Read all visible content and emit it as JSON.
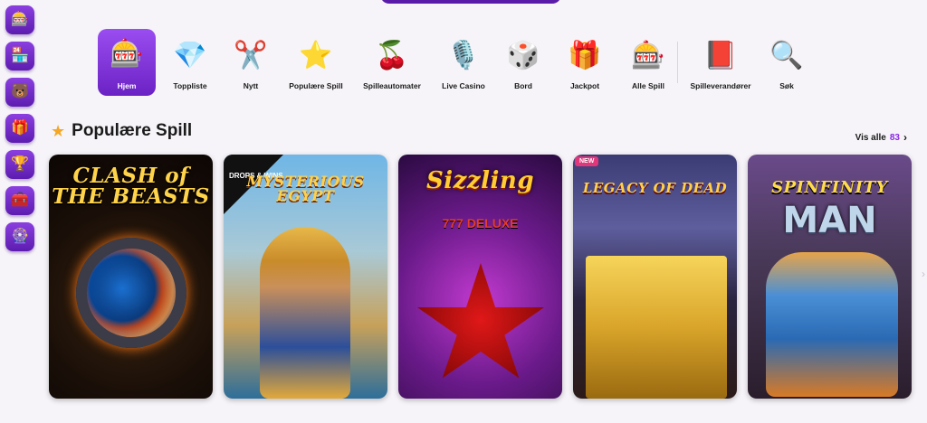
{
  "left_rail": [
    {
      "icon": "slot-machine-icon",
      "glyph": "🎰"
    },
    {
      "icon": "shop-icon",
      "glyph": "🏪"
    },
    {
      "icon": "mascot-icon",
      "glyph": "🐻"
    },
    {
      "icon": "gift-icon",
      "glyph": "🎁"
    },
    {
      "icon": "trophy-icon",
      "glyph": "🏆"
    },
    {
      "icon": "treasure-chest-icon",
      "glyph": "🧰"
    },
    {
      "icon": "wheel-icon",
      "glyph": "🎡"
    }
  ],
  "nav": {
    "items": [
      {
        "label": "Hjem",
        "icon": "home-slot-icon",
        "glyph": "🎰"
      },
      {
        "label": "Toppliste",
        "icon": "gem-icon",
        "glyph": "💎"
      },
      {
        "label": "Nytt",
        "icon": "scissors-ribbon-icon",
        "glyph": "✂️"
      },
      {
        "label": "Populære Spill",
        "icon": "star-icon",
        "glyph": "⭐"
      },
      {
        "label": "Spilleautomater",
        "icon": "cherries-icon",
        "glyph": "🍒"
      },
      {
        "label": "Live Casino",
        "icon": "microphone-icon",
        "glyph": "🎙️"
      },
      {
        "label": "Bord",
        "icon": "dice-icon",
        "glyph": "🎲"
      },
      {
        "label": "Jackpot",
        "icon": "jackpot-box-icon",
        "glyph": "🎁"
      },
      {
        "label": "Alle Spill",
        "icon": "slot-reel-icon",
        "glyph": "🎰"
      },
      {
        "label": "Spilleverandører",
        "icon": "book-icon",
        "glyph": "📕"
      },
      {
        "label": "Søk",
        "icon": "search-icon",
        "glyph": "🔍"
      }
    ]
  },
  "section": {
    "title": "Populære Spill",
    "view_all_label": "Vis alle",
    "view_all_count": "83"
  },
  "games": [
    {
      "title": "CLASH of THE BEASTS",
      "badge": ""
    },
    {
      "title": "MYSTERIOUS EGYPT",
      "badge": "DROPS & WINS"
    },
    {
      "title": "Sizzling",
      "subtitle": "777 DELUXE",
      "badge": ""
    },
    {
      "title": "LEGACY OF DEAD",
      "badge": "NEW"
    },
    {
      "title": "SPINFINITY",
      "subtitle": "MAN",
      "badge": ""
    }
  ]
}
